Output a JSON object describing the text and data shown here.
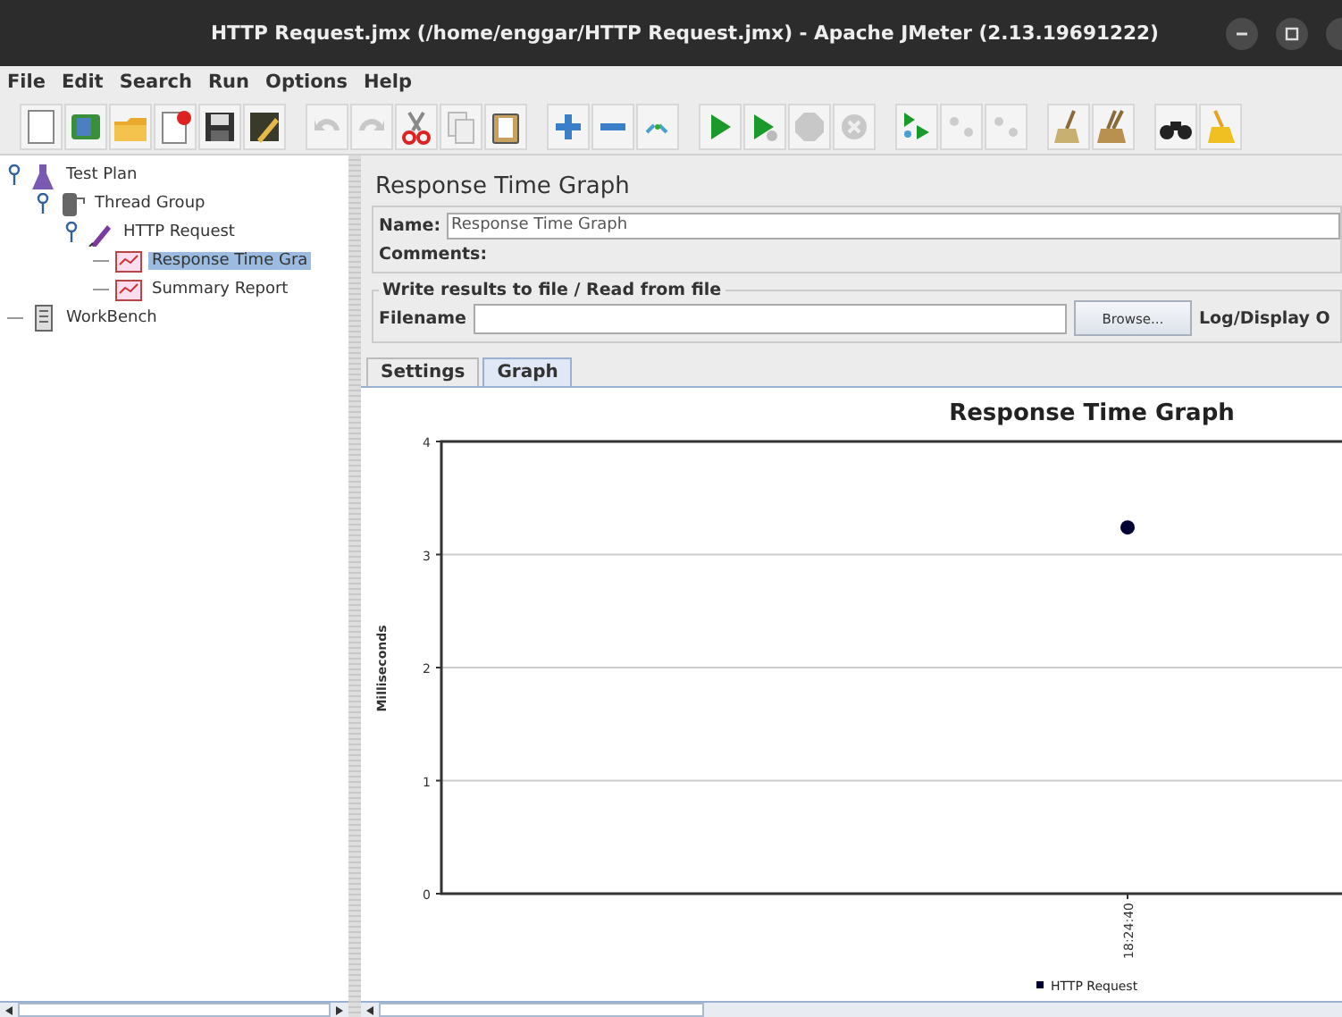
{
  "window": {
    "title": "HTTP Request.jmx (/home/enggar/HTTP Request.jmx) - Apache JMeter (2.13.19691222)"
  },
  "menu": [
    "File",
    "Edit",
    "Search",
    "Run",
    "Options",
    "Help"
  ],
  "tree": [
    {
      "label": "Test Plan",
      "kind": "plan",
      "expanded": true,
      "selected": false,
      "children": [
        {
          "label": "Thread Group",
          "kind": "threads",
          "expanded": true,
          "selected": false,
          "children": [
            {
              "label": "HTTP Request",
              "kind": "sampler",
              "expanded": true,
              "selected": false,
              "children": [
                {
                  "label": "Response Time Gra",
                  "kind": "listener",
                  "selected": true
                },
                {
                  "label": "Summary Report",
                  "kind": "listener",
                  "selected": false
                }
              ]
            }
          ]
        }
      ]
    },
    {
      "label": "WorkBench",
      "kind": "bench",
      "selected": false
    }
  ],
  "panel": {
    "title": "Response Time Graph",
    "name_label": "Name:",
    "name_value": "Response Time Graph",
    "comments_label": "Comments:",
    "file_group": {
      "title": "Write results to file / Read from file",
      "filename_label": "Filename",
      "browse": "Browse...",
      "log_label": "Log/Display O"
    },
    "tabs": [
      {
        "label": "Settings",
        "selected": false
      },
      {
        "label": "Graph",
        "selected": true
      }
    ],
    "chart_data": {
      "type": "scatter",
      "title": "Response Time Graph",
      "ylabel": "Milliseconds",
      "categories": [
        "18:24:40"
      ],
      "series": [
        {
          "name": "HTTP Request",
          "color": "#000033",
          "values": [
            3.24
          ]
        }
      ],
      "ylim": [
        0,
        4
      ],
      "yticks": [
        0,
        1,
        2,
        3,
        4
      ],
      "grid": true
    }
  }
}
